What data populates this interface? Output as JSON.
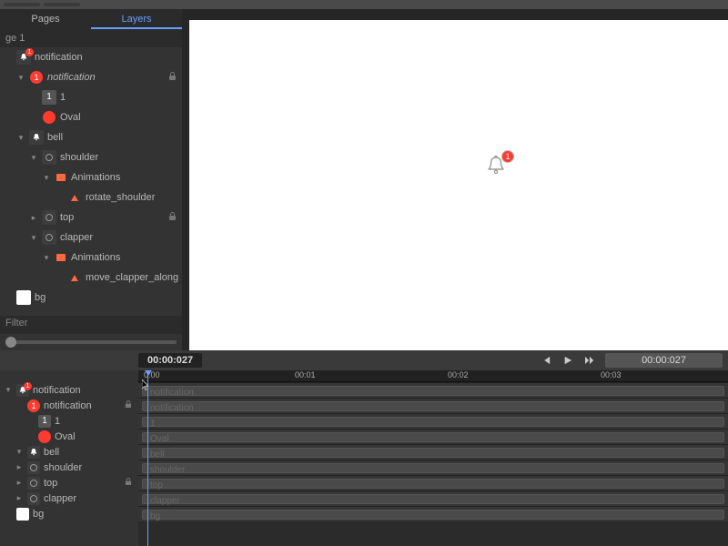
{
  "sidebar": {
    "tabs": {
      "pages": "Pages",
      "layers": "Layers"
    },
    "page_label": "ge 1",
    "layers": [
      {
        "name": "notification",
        "type": "bell-badge",
        "indent": 0,
        "twisty": "",
        "lock": false,
        "italic": false
      },
      {
        "name": "notification",
        "type": "badge",
        "indent": 1,
        "twisty": "▾",
        "lock": true,
        "italic": true
      },
      {
        "name": "1",
        "type": "one",
        "indent": 2,
        "twisty": "",
        "lock": false,
        "italic": false
      },
      {
        "name": "Oval",
        "type": "oval",
        "indent": 2,
        "twisty": "",
        "lock": false,
        "italic": false
      },
      {
        "name": "bell",
        "type": "bell",
        "indent": 1,
        "twisty": "▾",
        "lock": false,
        "italic": false
      },
      {
        "name": "shoulder",
        "type": "node",
        "indent": 2,
        "twisty": "▾",
        "lock": false,
        "italic": false
      },
      {
        "name": "Animations",
        "type": "anim",
        "indent": 3,
        "twisty": "▾",
        "lock": false,
        "italic": false
      },
      {
        "name": "rotate_shoulder",
        "type": "tri",
        "indent": 4,
        "twisty": "",
        "lock": false,
        "italic": false
      },
      {
        "name": "top",
        "type": "node",
        "indent": 2,
        "twisty": "▸",
        "lock": true,
        "italic": false
      },
      {
        "name": "clapper",
        "type": "node",
        "indent": 2,
        "twisty": "▾",
        "lock": false,
        "italic": false
      },
      {
        "name": "Animations",
        "type": "anim",
        "indent": 3,
        "twisty": "▾",
        "lock": false,
        "italic": false
      },
      {
        "name": "move_clapper_along",
        "type": "tri",
        "indent": 4,
        "twisty": "",
        "lock": false,
        "italic": false
      },
      {
        "name": "bg",
        "type": "white",
        "indent": 0,
        "twisty": "",
        "lock": false,
        "italic": false
      }
    ],
    "filter_placeholder": "Filter"
  },
  "canvas": {
    "badge_number": "1"
  },
  "transport": {
    "timecode": "00:00:027",
    "display": "00:00:027"
  },
  "timeline": {
    "ruler_ticks": [
      "0:00",
      "00:01",
      "00:02",
      "00:03"
    ],
    "rows": [
      {
        "name": "notification",
        "type": "bell-badge",
        "indent": 0,
        "twisty": "▾",
        "lock": false
      },
      {
        "name": "notification",
        "type": "badge",
        "indent": 1,
        "twisty": "",
        "lock": true
      },
      {
        "name": "1",
        "type": "one",
        "indent": 2,
        "twisty": "",
        "lock": false
      },
      {
        "name": "Oval",
        "type": "oval",
        "indent": 2,
        "twisty": "",
        "lock": false
      },
      {
        "name": "bell",
        "type": "bell",
        "indent": 1,
        "twisty": "▾",
        "lock": false
      },
      {
        "name": "shoulder",
        "type": "node",
        "indent": 1,
        "twisty": "▸",
        "lock": false
      },
      {
        "name": "top",
        "type": "node",
        "indent": 1,
        "twisty": "▸",
        "lock": true
      },
      {
        "name": "clapper",
        "type": "node",
        "indent": 1,
        "twisty": "▸",
        "lock": false
      },
      {
        "name": "bg",
        "type": "white",
        "indent": 0,
        "twisty": "",
        "lock": false
      }
    ]
  }
}
